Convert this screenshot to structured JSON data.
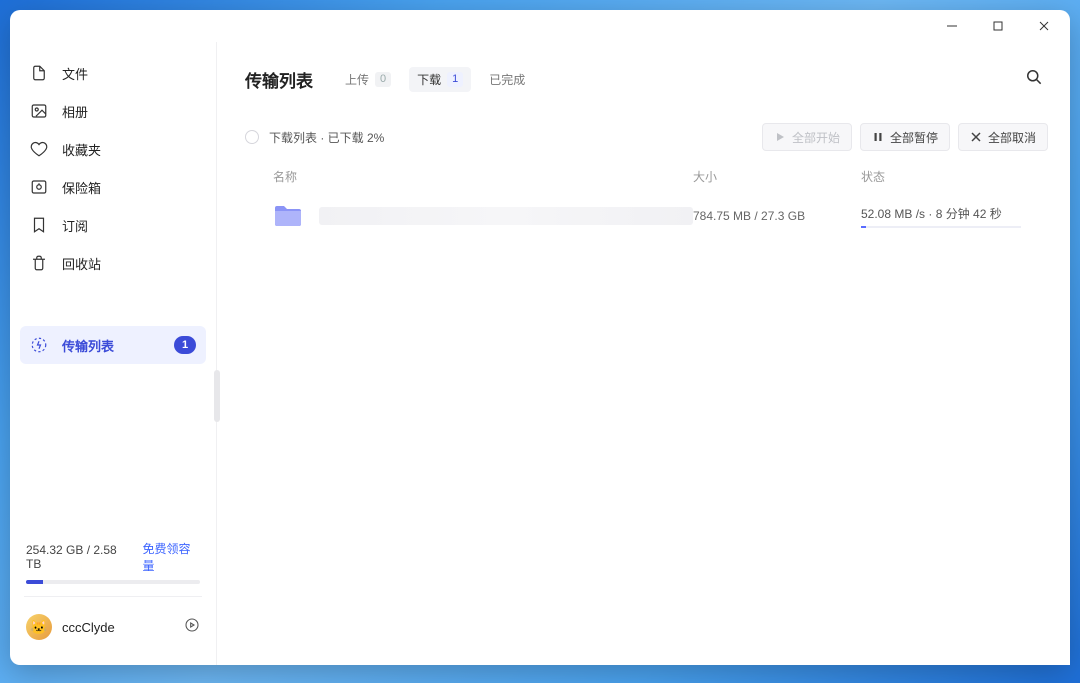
{
  "sidebar": {
    "items": [
      {
        "label": "文件"
      },
      {
        "label": "相册"
      },
      {
        "label": "收藏夹"
      },
      {
        "label": "保险箱"
      },
      {
        "label": "订阅"
      },
      {
        "label": "回收站"
      }
    ],
    "transfer": {
      "label": "传输列表",
      "badge": "1"
    }
  },
  "storage": {
    "text": "254.32 GB / 2.58 TB",
    "link": "免费领容量"
  },
  "account": {
    "name": "cccClyde"
  },
  "main": {
    "title": "传输列表",
    "tabs": {
      "upload": {
        "label": "上传",
        "count": "0"
      },
      "download": {
        "label": "下载",
        "count": "1"
      },
      "done": {
        "label": "已完成"
      }
    },
    "status": "下载列表 · 已下载 2%",
    "buttons": {
      "start": "全部开始",
      "pause": "全部暂停",
      "cancel": "全部取消"
    },
    "columns": {
      "name": "名称",
      "size": "大小",
      "state": "状态"
    },
    "row": {
      "size": "784.75 MB / 27.3 GB",
      "state": "52.08 MB /s · 8 分钟 42 秒"
    }
  }
}
